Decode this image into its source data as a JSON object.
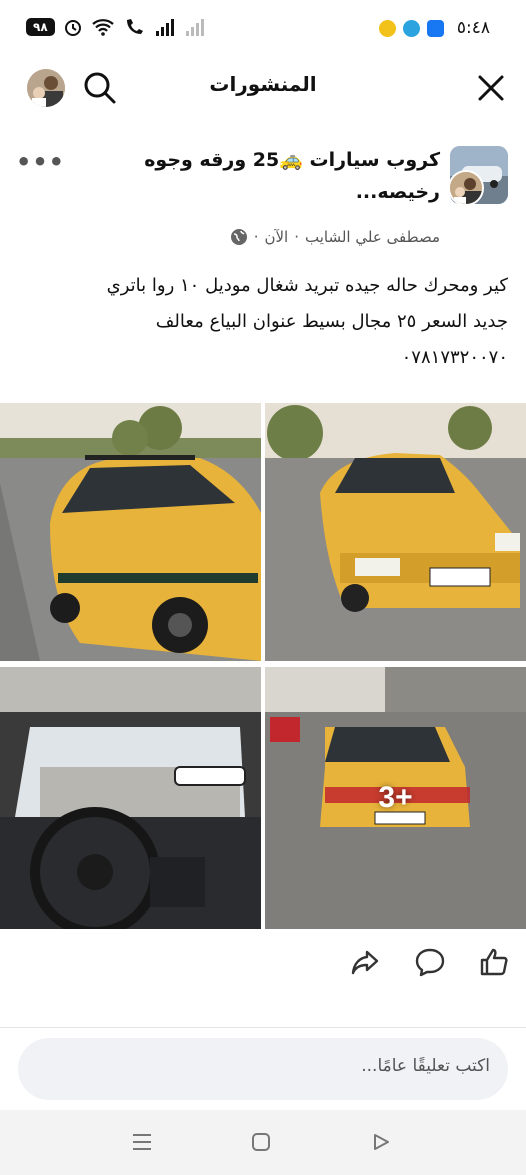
{
  "status_bar": {
    "time": "٥:٤٨",
    "battery": "٩٨",
    "icons": [
      "facebook-icon",
      "telegram-icon",
      "yellow-app-icon",
      "alarm-icon",
      "wifi-icon",
      "call-signal-icon",
      "signal-bars-icon",
      "signal-bars-2-icon"
    ]
  },
  "header": {
    "title": "المنشورات"
  },
  "post": {
    "group_name": "كروب سيارات 🚕25 ورقه وجوه رخيصه...",
    "author": "مصطفى علي الشايب",
    "time_ago": "الآن",
    "separator": "·",
    "body_lines": [
      "كير ومحرك حاله جيده تبريد شغال موديل ١٠ روا باتري",
      "جديد السعر ٢٥ مجال بسيط عنوان البياع معالف",
      "٠٧٨١٧٣٢٠٠٧٠"
    ],
    "more_photos_label": "3+"
  },
  "comment": {
    "placeholder": "اكتب تعليقًا عامًا..."
  },
  "colors": {
    "taxi_yellow": "#e8b33a",
    "facebook_blue": "#1877f2",
    "telegram_blue": "#2aa3df"
  }
}
